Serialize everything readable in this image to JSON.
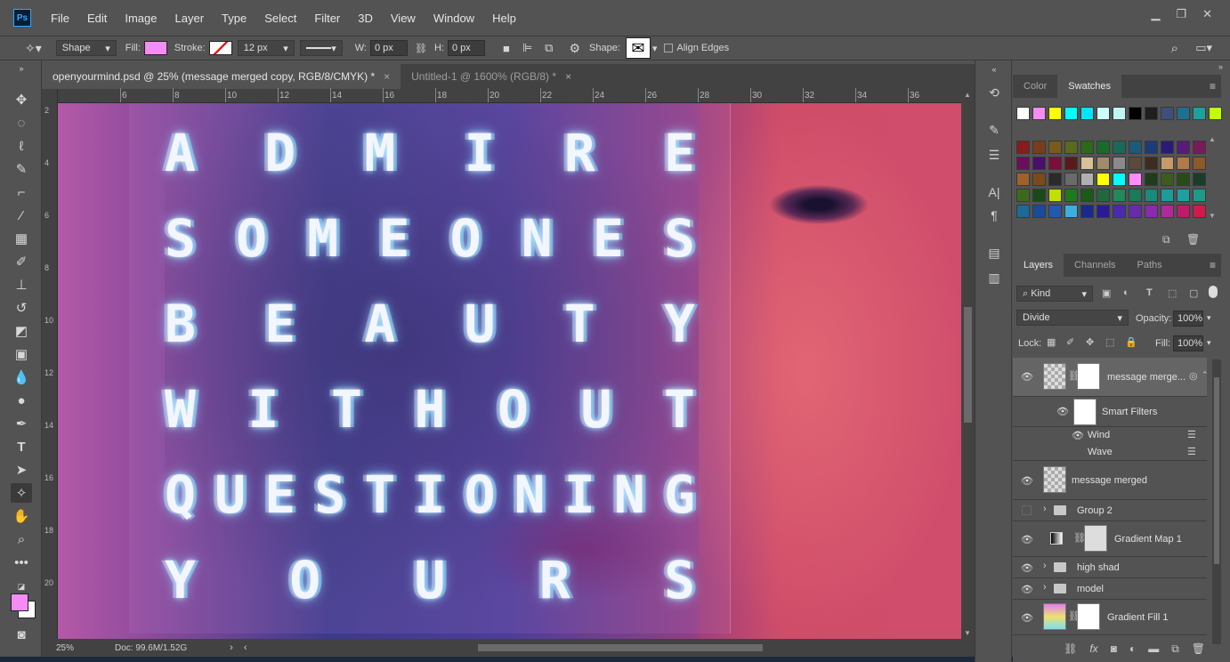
{
  "app": {
    "logo": "Ps"
  },
  "menu": [
    "File",
    "Edit",
    "Image",
    "Layer",
    "Type",
    "Select",
    "Filter",
    "3D",
    "View",
    "Window",
    "Help"
  ],
  "window_controls": {
    "minimize": "▁",
    "restore": "❐",
    "close": "✕"
  },
  "options": {
    "tool_mode": "Shape",
    "fill_label": "Fill:",
    "fill_color": "#f58cf5",
    "stroke_label": "Stroke:",
    "stroke_size": "12 px",
    "w_label": "W:",
    "w_value": "0 px",
    "h_label": "H:",
    "h_value": "0 px",
    "shape_label": "Shape:",
    "align_edges": "Align Edges"
  },
  "tabs": [
    {
      "label": "openyourmind.psd @ 25% (message merged copy, RGB/8/CMYK) *",
      "close": "×"
    },
    {
      "label": "Untitled-1 @ 1600% (RGB/8) *",
      "close": "×"
    }
  ],
  "ruler": {
    "h_labels": [
      "6",
      "8",
      "10",
      "12",
      "14",
      "16",
      "18",
      "20",
      "22",
      "24",
      "26",
      "28",
      "30",
      "32",
      "34",
      "36"
    ],
    "v_labels": [
      "2",
      "4",
      "6",
      "8",
      "10",
      "12",
      "14",
      "16",
      "18",
      "20"
    ]
  },
  "poster_text": [
    "ADMIRE",
    "SOMEONES",
    "BEAUTY",
    "WITHOUT",
    "QUESTIONING",
    "YOURS"
  ],
  "status": {
    "zoom": "25%",
    "doc": "Doc: 99.6M/1.52G"
  },
  "color_panel": {
    "tabs": [
      "Color",
      "Swatches"
    ],
    "active": "Swatches"
  },
  "swatches": {
    "top_row": [
      "#ffffff",
      "#f58cf5",
      "#ffff00",
      "#00ffff",
      "#00e5ff",
      "#ccffff",
      "#bff5f5",
      "#000000",
      "#1f1f1f",
      "#3d4f7a",
      "#1f6f8f",
      "#1fa0a0",
      "#c0ff00"
    ],
    "grid": [
      [
        "#8b1a1a",
        "#7a3d1a",
        "#7a5a1a",
        "#5a6a1a",
        "#2a6a1a",
        "#1a6a2a",
        "#1a6a5a",
        "#1a5a7a",
        "#1a3d7a",
        "#2a1a7a",
        "#5a1a7a",
        "#7a1a5a"
      ],
      [
        "#6a0f5a",
        "#4a0f6a",
        "#7a0f3a",
        "#5a1a1a",
        "#d9c09a",
        "#a08c6a",
        "#8a8a8a",
        "#5a4a3a",
        "#3d2d1f",
        "#c89a6a",
        "#b07a4a",
        "#8a5a2a"
      ],
      [
        "#a0622a",
        "#7a4a1a",
        "#2a2a2a",
        "#6a6a6a",
        "#b0b0b0",
        "#ffff00",
        "#00ffff",
        "#ff8cff",
        "#1f3d1a",
        "#3d5a1f",
        "#2a4a1a",
        "#1a3d2a"
      ],
      [
        "#3d6a1a",
        "#1a4a1a",
        "#c0e000",
        "#1f7a1f",
        "#1a5a1a",
        "#1f6a3d",
        "#1f8a5a",
        "#1a7a5a",
        "#1a8a7a",
        "#1f9a9a",
        "#1fa0a0",
        "#1f9a8a"
      ],
      [
        "#1a6a9a",
        "#1a4a9a",
        "#1f5ab0",
        "#3ab0e0",
        "#1a2a8a",
        "#2a1a9a",
        "#4a2ab0",
        "#6a2ab0",
        "#8a2ab0",
        "#b02a9a",
        "#c01a6a",
        "#d01a4a"
      ]
    ]
  },
  "layers_panel": {
    "tabs": [
      "Layers",
      "Channels",
      "Paths"
    ],
    "active": "Layers",
    "kind_filter": "Kind",
    "blend_mode": "Divide",
    "opacity_label": "Opacity:",
    "opacity": "100%",
    "lock_label": "Lock:",
    "fill_label": "Fill:",
    "fill": "100%",
    "layers": [
      {
        "name": "message merge...",
        "visible": true,
        "selected": true
      },
      {
        "name": "Smart Filters",
        "visible": true,
        "sub": true
      },
      {
        "name": "Wind",
        "visible": true,
        "filter": true
      },
      {
        "name": "Wave",
        "visible": false,
        "filter": true
      },
      {
        "name": "message merged",
        "visible": true
      },
      {
        "name": "Group 2",
        "visible": false,
        "group": true
      },
      {
        "name": "Gradient Map 1",
        "visible": true
      },
      {
        "name": "high shad",
        "visible": true,
        "group": true
      },
      {
        "name": "model",
        "visible": true,
        "group": true
      },
      {
        "name": "Gradient Fill 1",
        "visible": true
      }
    ]
  }
}
